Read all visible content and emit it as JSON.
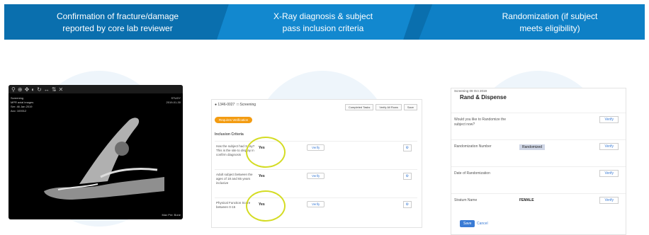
{
  "banner": {
    "step1_line1": "Confirmation of fracture/damage",
    "step1_line2": "reported by core lab reviewer",
    "step2_line1": "X-Ray diagnosis & subject",
    "step2_line2": "pass inclusion criteria",
    "step3_line1": "Randomization (if subject",
    "step3_line2": "meets eligibility)"
  },
  "viewer": {
    "toolbar_icons": [
      "search",
      "zoom",
      "pan",
      "contrast",
      "rotate",
      "measure",
      "flip",
      "reset"
    ],
    "meta_left": [
      "Screening",
      "MPR axial images",
      "Ser: 46 Jan 2019",
      "Acc: 100012"
    ],
    "meta_right": [
      "STUDY",
      "2019-01-30"
    ],
    "footer_right": "Max Pre: Bone"
  },
  "form": {
    "subject_line": "1346-0027",
    "status": "Screening",
    "tabs": [
      "Completed Tasks",
      "Verify All Rows",
      "Save"
    ],
    "pill": "Requires Verification",
    "section": "Inclusion Criteria",
    "rows": [
      {
        "question": "Has the subject had X-ray? This is the site to display in confirm diagnosis",
        "answer": "Yes",
        "verify": "Verify"
      },
      {
        "question": "Adult subject between the ages of 18 and 65 years inclusive",
        "answer": "Yes",
        "verify": "Verify"
      },
      {
        "question": "Physical Function Score between 0-15",
        "answer": "Yes",
        "verify": "Verify"
      }
    ]
  },
  "randomize": {
    "header": "Screening 09 Oct 2019",
    "title": "Rand & Dispense",
    "rows": [
      {
        "label": "Would you like to Randomize the subject now?",
        "value": "",
        "button": "Verify"
      },
      {
        "label": "Randomization Number",
        "value": "Randomized",
        "button": "Verify"
      },
      {
        "label": "Date of Randomization",
        "value": "",
        "button": "Verify"
      },
      {
        "label": "Stratum Name",
        "value": "FEMALE",
        "button": "Verify"
      }
    ],
    "save": "Save",
    "cancel": "Cancel"
  }
}
